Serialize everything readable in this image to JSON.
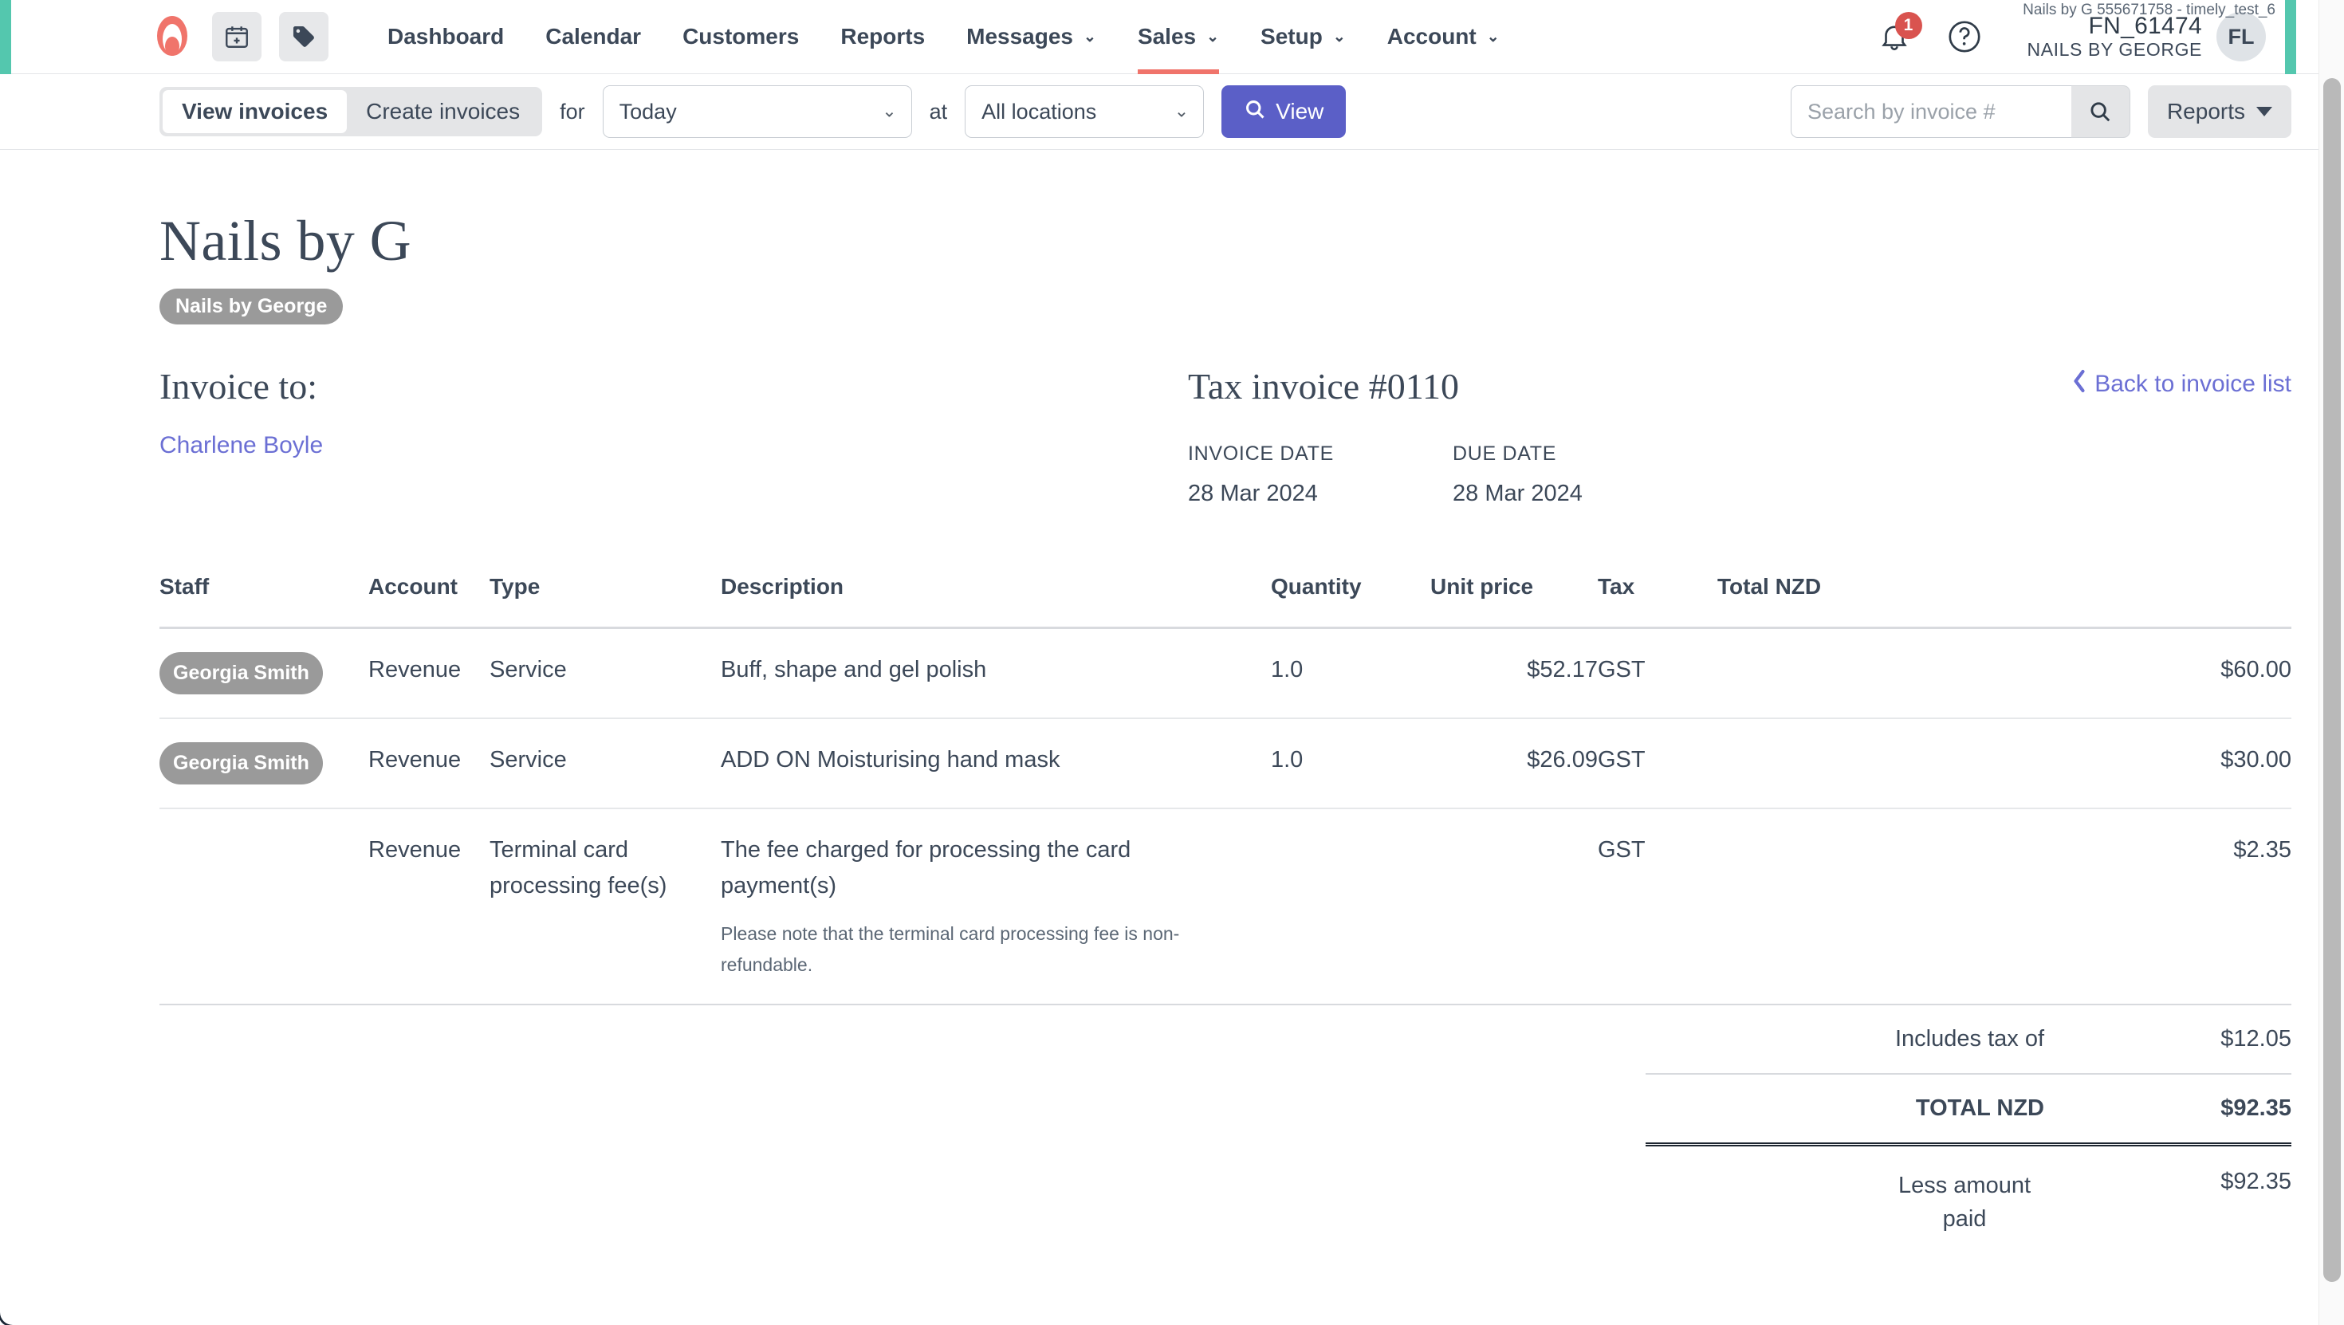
{
  "header": {
    "logo_icon": "timely-logo-icon",
    "quick_actions": [
      {
        "icon": "calendar-add-icon",
        "name": "new-appointment-button"
      },
      {
        "icon": "tag-icon",
        "name": "new-sale-button"
      }
    ],
    "nav": [
      {
        "label": "Dashboard",
        "has_caret": false,
        "active": false
      },
      {
        "label": "Calendar",
        "has_caret": false,
        "active": false
      },
      {
        "label": "Customers",
        "has_caret": false,
        "active": false
      },
      {
        "label": "Reports",
        "has_caret": false,
        "active": false
      },
      {
        "label": "Messages",
        "has_caret": true,
        "active": false
      },
      {
        "label": "Sales",
        "has_caret": true,
        "active": true
      },
      {
        "label": "Setup",
        "has_caret": true,
        "active": false
      },
      {
        "label": "Account",
        "has_caret": true,
        "active": false
      }
    ],
    "notifications_count": "1",
    "notification_icon": "bell-icon",
    "help_icon": "help-circle-icon",
    "account_top_line": "Nails by G 555671758 - timely_test_6",
    "account_id": "FN_61474",
    "account_business": "NAILS BY GEORGE",
    "avatar_initials": "FL",
    "accent_color": "#54c7ae",
    "active_tab_color": "#f0746b"
  },
  "toolbar": {
    "tabs": [
      {
        "label": "View invoices",
        "active": true
      },
      {
        "label": "Create invoices",
        "active": false
      }
    ],
    "for_label": "for",
    "date_filter": {
      "value": "Today"
    },
    "at_label": "at",
    "location_filter": {
      "value": "All locations"
    },
    "view_button": {
      "label": "View",
      "icon": "search-icon",
      "color": "#5b5fc7"
    },
    "search": {
      "placeholder": "Search by invoice #",
      "value": "",
      "icon": "search-icon"
    },
    "reports_button": {
      "label": "Reports",
      "icon": "caret-down-icon"
    }
  },
  "page": {
    "back_link": "Back to invoice list",
    "back_icon": "chevron-left-icon",
    "business_title": "Nails by G",
    "business_pill": "Nails by George",
    "invoice_to_heading": "Invoice to:",
    "customer_name": "Charlene Boyle",
    "tax_invoice_heading": "Tax invoice #0110",
    "invoice_date_label": "INVOICE DATE",
    "invoice_date_value": "28 Mar 2024",
    "due_date_label": "DUE DATE",
    "due_date_value": "28 Mar 2024",
    "link_color": "#6b6fd4"
  },
  "items_table": {
    "columns": [
      "Staff",
      "Account",
      "Type",
      "Description",
      "Quantity",
      "Unit price",
      "Tax",
      "Total NZD"
    ],
    "rows": [
      {
        "staff": "Georgia Smith",
        "account": "Revenue",
        "type": "Service",
        "description": "Buff, shape and gel polish",
        "description_note": "",
        "quantity": "1.0",
        "unit_price": "$52.17",
        "tax": "GST",
        "total": "$60.00"
      },
      {
        "staff": "Georgia Smith",
        "account": "Revenue",
        "type": "Service",
        "description": "ADD ON Moisturising hand mask",
        "description_note": "",
        "quantity": "1.0",
        "unit_price": "$26.09",
        "tax": "GST",
        "total": "$30.00"
      },
      {
        "staff": "",
        "account": "Revenue",
        "type": "Terminal card processing fee(s)",
        "description": "The fee charged for processing the card payment(s)",
        "description_note": "Please note that the terminal card processing fee is non-refundable.",
        "quantity": "",
        "unit_price": "",
        "tax": "GST",
        "total": "$2.35"
      }
    ]
  },
  "totals": {
    "tax_label": "Includes tax of",
    "tax_value": "$12.05",
    "total_label": "TOTAL NZD",
    "total_value": "$92.35",
    "paid_label": "Less amount paid",
    "paid_value": "$92.35"
  }
}
